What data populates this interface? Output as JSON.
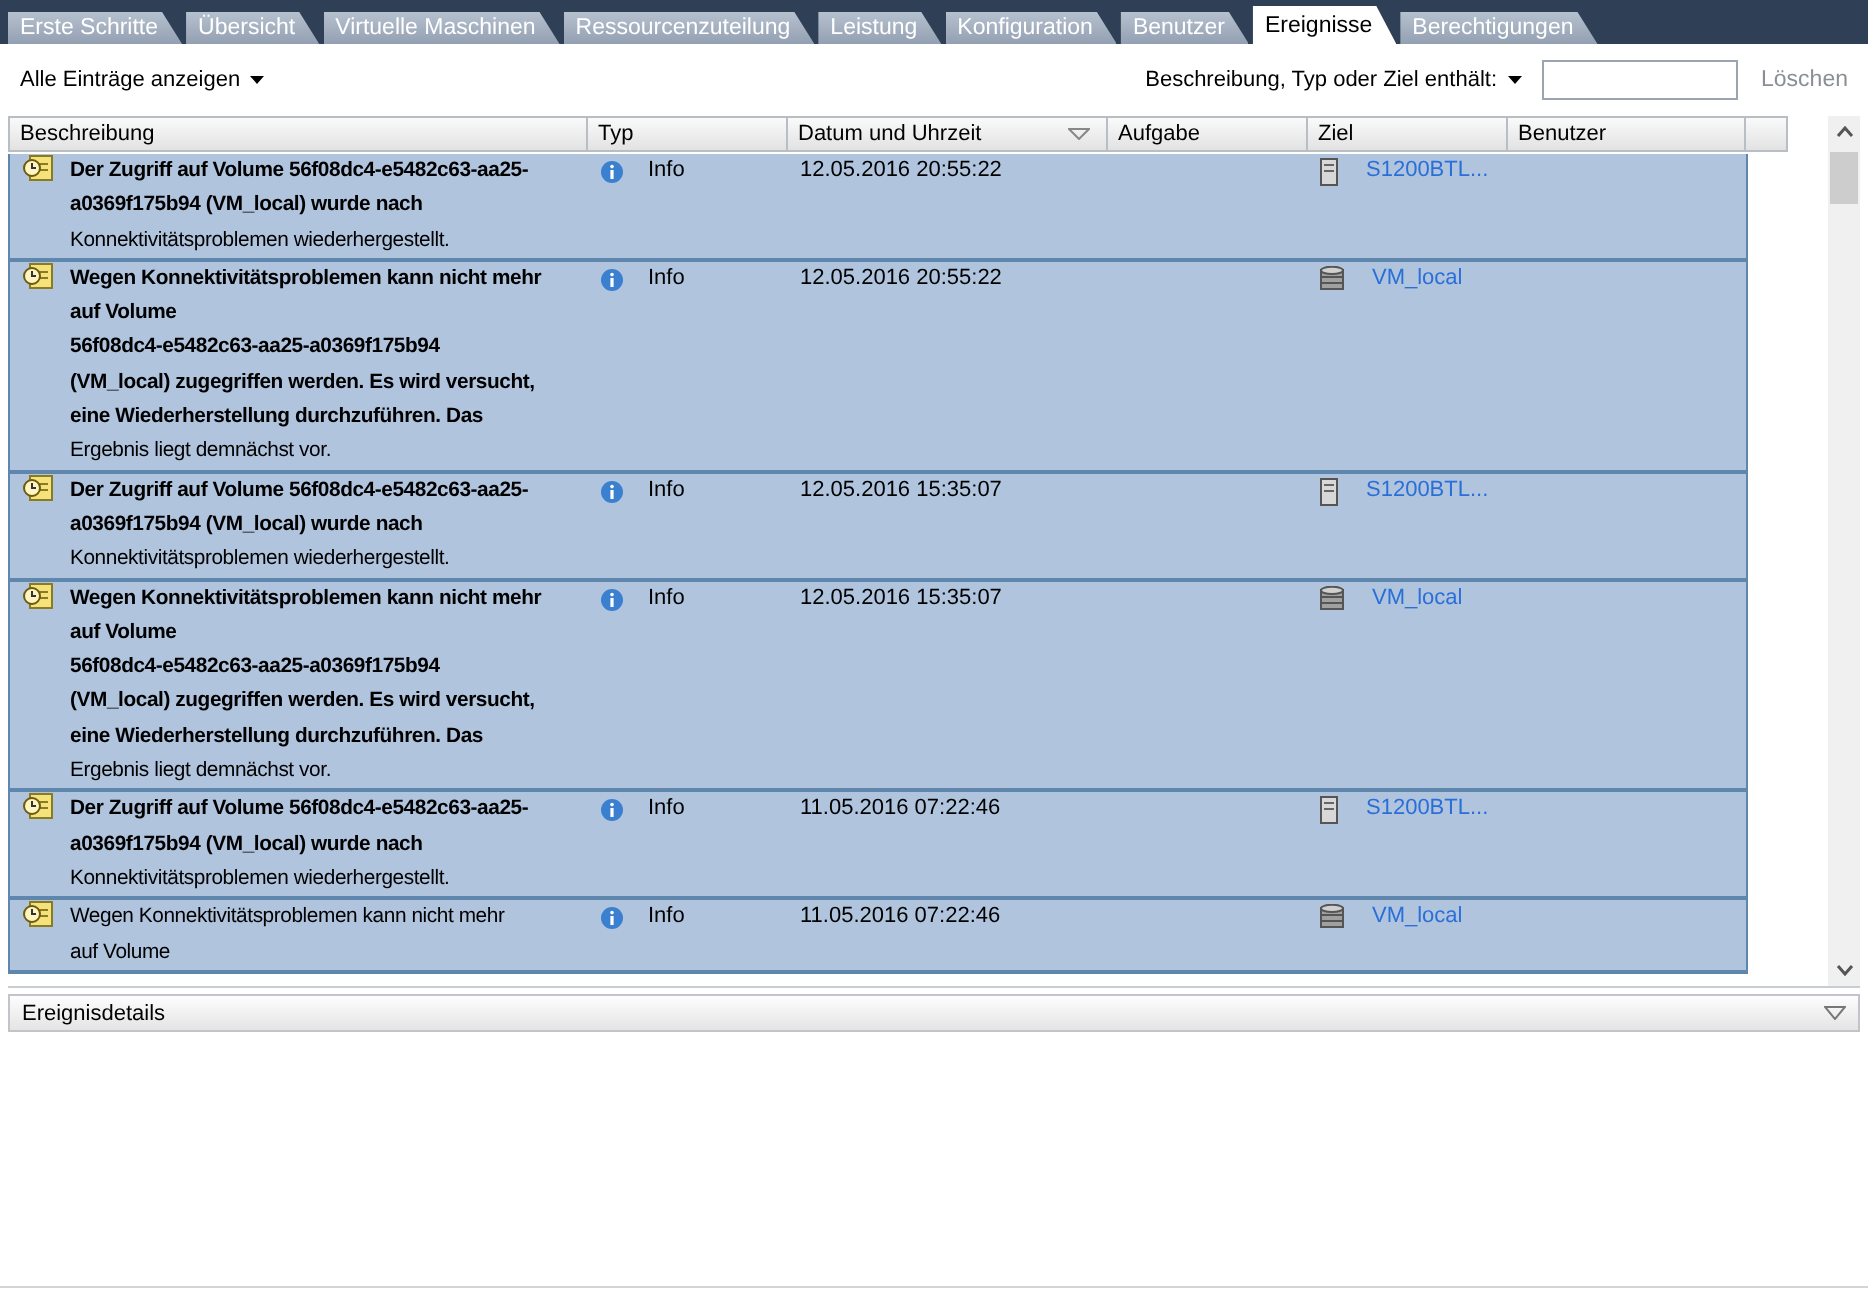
{
  "tabs": [
    {
      "label": "Erste Schritte",
      "selected": false
    },
    {
      "label": "Übersicht",
      "selected": false
    },
    {
      "label": "Virtuelle Maschinen",
      "selected": false
    },
    {
      "label": "Ressourcenzuteilung",
      "selected": false
    },
    {
      "label": "Leistung",
      "selected": false
    },
    {
      "label": "Konfiguration",
      "selected": false
    },
    {
      "label": "Benutzer",
      "selected": false
    },
    {
      "label": "Ereignisse",
      "selected": true
    },
    {
      "label": "Berechtigungen",
      "selected": false
    }
  ],
  "toolbar": {
    "view_menu": "Alle Einträge anzeigen",
    "filter_menu": "Beschreibung, Typ oder Ziel enthält:",
    "clear_button": "Löschen"
  },
  "table": {
    "columns": [
      {
        "label": "Beschreibung",
        "sorted": false
      },
      {
        "label": "Typ",
        "sorted": false
      },
      {
        "label": "Datum und Uhrzeit",
        "sorted": true
      },
      {
        "label": "Aufgabe",
        "sorted": false
      },
      {
        "label": "Ziel",
        "sorted": false
      },
      {
        "label": "Benutzer",
        "sorted": false
      }
    ],
    "rows": [
      {
        "selected": true,
        "description": [
          "**Der Zugriff auf Volume 56f08dc4-e5482c63-aa25-**",
          "**a0369f175b94 (VM_local) wurde nach**",
          "Konnektivitätsproblemen wiederhergestellt."
        ],
        "type": "Info",
        "datetime": "12.05.2016 20:55:22",
        "target": {
          "kind": "host",
          "label": "S1200BTL..."
        }
      },
      {
        "selected": true,
        "description": [
          "**Wegen Konnektivitätsproblemen kann nicht mehr**",
          "**auf Volume**",
          "**56f08dc4-e5482c63-aa25-a0369f175b94**",
          "**(VM_local) zugegriffen werden. Es wird versucht,**",
          "**eine Wiederherstellung durchzuführen. Das**",
          "Ergebnis liegt demnächst vor."
        ],
        "type": "Info",
        "datetime": "12.05.2016 20:55:22",
        "target": {
          "kind": "datastore",
          "label": "VM_local"
        }
      },
      {
        "selected": true,
        "description": [
          "**Der Zugriff auf Volume 56f08dc4-e5482c63-aa25-**",
          "**a0369f175b94 (VM_local) wurde nach**",
          "Konnektivitätsproblemen wiederhergestellt."
        ],
        "type": "Info",
        "datetime": "12.05.2016 15:35:07",
        "target": {
          "kind": "host",
          "label": "S1200BTL..."
        }
      },
      {
        "selected": true,
        "description": [
          "**Wegen Konnektivitätsproblemen kann nicht mehr**",
          "**auf Volume**",
          "**56f08dc4-e5482c63-aa25-a0369f175b94**",
          "**(VM_local) zugegriffen werden. Es wird versucht,**",
          "**eine Wiederherstellung durchzuführen. Das**",
          "Ergebnis liegt demnächst vor."
        ],
        "type": "Info",
        "datetime": "12.05.2016 15:35:07",
        "target": {
          "kind": "datastore",
          "label": "VM_local"
        }
      },
      {
        "selected": true,
        "description": [
          "**Der Zugriff auf Volume 56f08dc4-e5482c63-aa25-**",
          "**a0369f175b94 (VM_local) wurde nach**",
          "Konnektivitätsproblemen wiederhergestellt."
        ],
        "type": "Info",
        "datetime": "11.05.2016 07:22:46",
        "target": {
          "kind": "host",
          "label": "S1200BTL..."
        }
      },
      {
        "selected": true,
        "description": [
          "Wegen Konnektivitätsproblemen kann nicht mehr",
          "auf Volume"
        ],
        "type": "Info",
        "datetime": "11.05.2016 07:22:46",
        "target": {
          "kind": "datastore",
          "label": "VM_local"
        }
      }
    ]
  },
  "details_panel": {
    "title": "Ereignisdetails",
    "expanded": false
  }
}
